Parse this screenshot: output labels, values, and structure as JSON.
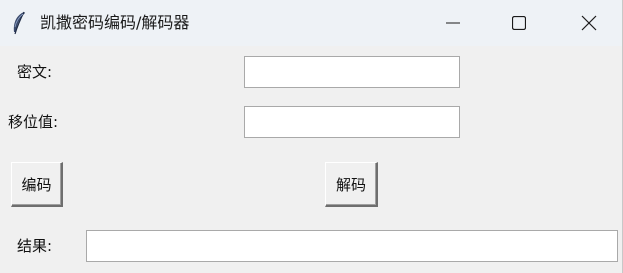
{
  "window": {
    "title": "凯撒密码编码/解码器"
  },
  "form": {
    "ciphertext_label": "密文:",
    "ciphertext_value": "",
    "shift_label": "移位值:",
    "shift_value": "",
    "encode_label": "编码",
    "decode_label": "解码",
    "result_label": "结果:",
    "result_value": ""
  },
  "icons": {
    "app": "feather-icon",
    "minimize": "minimize-icon",
    "maximize": "maximize-icon",
    "close": "close-icon"
  }
}
